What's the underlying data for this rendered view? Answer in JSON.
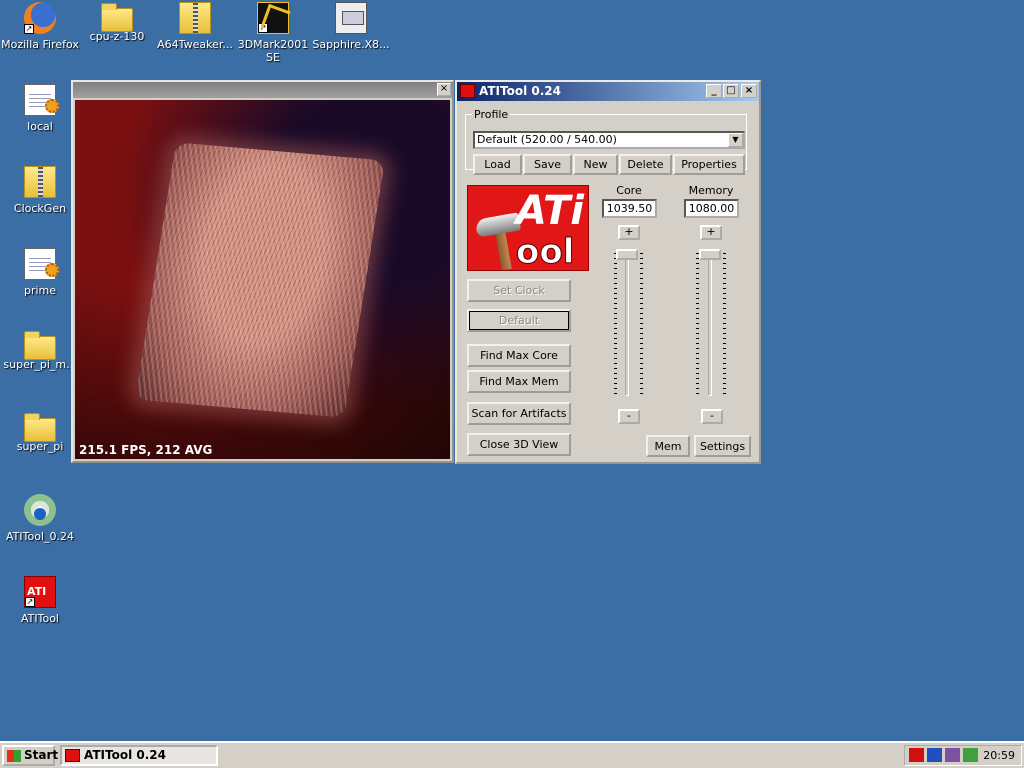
{
  "desktop": {
    "icons": [
      {
        "label": "Mozilla Firefox"
      },
      {
        "label": "cpu-z-130"
      },
      {
        "label": "A64Tweaker..."
      },
      {
        "label": "3DMark2001 SE"
      },
      {
        "label": "Sapphire.X8..."
      },
      {
        "label": "local"
      },
      {
        "label": "ClockGen"
      },
      {
        "label": "prime"
      },
      {
        "label": "super_pi_m..."
      },
      {
        "label": "super_pi"
      },
      {
        "label": "ATITool_0.24"
      },
      {
        "label": "ATITool"
      }
    ]
  },
  "view3d": {
    "close": "×",
    "fps_text": "215.1 FPS, 212 AVG"
  },
  "atitool": {
    "title": "ATITool 0.24",
    "title_buttons": {
      "minimize": "_",
      "maximize": "□",
      "close": "×"
    },
    "profile": {
      "legend": "Profile",
      "selected": "Default (520.00 / 540.00)",
      "buttons": {
        "load": "Load",
        "save": "Save",
        "new": "New",
        "delete": "Delete",
        "properties": "Properties"
      }
    },
    "logo": {
      "top": "ATi",
      "bottom": "ool"
    },
    "core": {
      "label": "Core",
      "value": "1039.50",
      "plus": "+",
      "minus": "-"
    },
    "memory": {
      "label": "Memory",
      "value": "1080.00",
      "plus": "+",
      "minus": "-"
    },
    "buttons": {
      "set_clock": "Set Clock",
      "default": "Default",
      "find_max_core": "Find Max Core",
      "find_max_mem": "Find Max Mem",
      "scan_artifacts": "Scan for Artifacts",
      "close_3d": "Close 3D View",
      "mem": "Mem",
      "settings": "Settings"
    }
  },
  "taskbar": {
    "start": "Start",
    "task_label": "ATITool 0.24",
    "clock": "20:59"
  }
}
